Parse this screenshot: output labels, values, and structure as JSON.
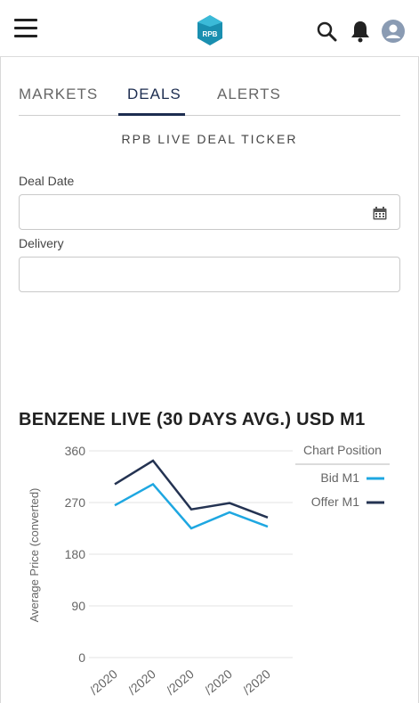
{
  "header": {
    "menu_icon": "hamburger-icon",
    "logo_text": "RPB",
    "search_icon": "search-icon",
    "bell_icon": "bell-icon",
    "avatar_icon": "user-avatar-icon"
  },
  "tabs": [
    {
      "label": "MARKETS",
      "active": false
    },
    {
      "label": "DEALS",
      "active": true
    },
    {
      "label": "ALERTS",
      "active": false
    }
  ],
  "ticker": {
    "title": "RPB LIVE DEAL TICKER"
  },
  "form": {
    "deal_date_label": "Deal Date",
    "deal_date_value": "",
    "delivery_label": "Delivery",
    "delivery_value": ""
  },
  "colors": {
    "primary": "#1d2d50",
    "bid": "#1ea7e1",
    "offer": "#243352",
    "logo": "#1a8fb0"
  },
  "chart_data": {
    "type": "line",
    "title": "BENZENE LIVE (30 DAYS AVG.) USD M1",
    "ylabel": "Average Price (converted)",
    "ylim": [
      0,
      360
    ],
    "yticks": [
      0,
      90,
      180,
      270,
      360
    ],
    "categories": [
      "/2020",
      "/2020",
      "/2020",
      "/2020",
      "/2020"
    ],
    "legend_title": "Chart Position",
    "legend_position": "top-right",
    "grid": true,
    "series": [
      {
        "name": "Bid M1",
        "color": "#1ea7e1",
        "values": [
          265,
          302,
          225,
          253,
          228
        ]
      },
      {
        "name": "Offer M1",
        "color": "#243352",
        "values": [
          302,
          343,
          258,
          269,
          244
        ]
      }
    ]
  }
}
